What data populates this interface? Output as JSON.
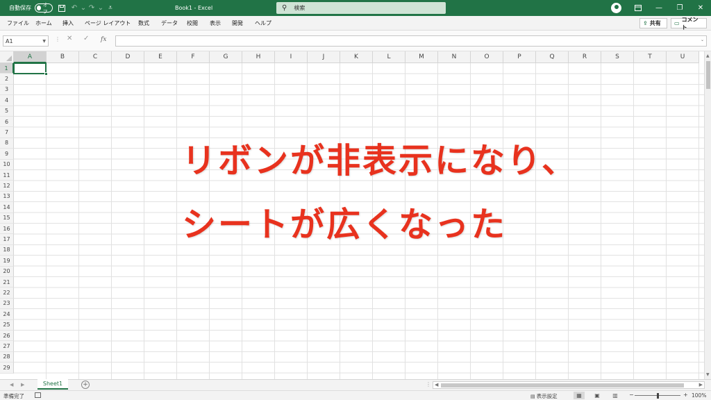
{
  "colors": {
    "excel_green": "#217346",
    "annotation_red": "#e8321e"
  },
  "titlebar": {
    "autosave_label": "自動保存",
    "autosave_state": "オフ",
    "title": "Book1 - Excel",
    "search_placeholder": "検索",
    "icons": [
      "save-icon",
      "undo-icon",
      "redo-icon",
      "customize-icon",
      "search-icon",
      "avatar-icon",
      "ribbon-display-icon",
      "minimize-icon",
      "restore-icon",
      "close-icon"
    ]
  },
  "menu": {
    "tabs": [
      "ファイル",
      "ホーム",
      "挿入",
      "ページ レイアウト",
      "数式",
      "データ",
      "校閲",
      "表示",
      "開発",
      "ヘルプ"
    ],
    "share": "共有",
    "comment": "コメント"
  },
  "formula_bar": {
    "name_box": "A1",
    "fx": "fx",
    "value": ""
  },
  "grid": {
    "columns": [
      "A",
      "B",
      "C",
      "D",
      "E",
      "F",
      "G",
      "H",
      "I",
      "J",
      "K",
      "L",
      "M",
      "N",
      "O",
      "P",
      "Q",
      "R",
      "S",
      "T",
      "U"
    ],
    "rows": [
      "1",
      "2",
      "3",
      "4",
      "5",
      "6",
      "7",
      "8",
      "9",
      "10",
      "11",
      "12",
      "13",
      "14",
      "15",
      "16",
      "17",
      "18",
      "19",
      "20",
      "21",
      "22",
      "23",
      "24",
      "25",
      "26",
      "27",
      "28",
      "29"
    ],
    "active_cell": "A1"
  },
  "annotation": {
    "line1": "リボンが非表示になり、",
    "line2": "シートが広くなった"
  },
  "sheets": {
    "tabs": [
      "Sheet1"
    ],
    "active": "Sheet1"
  },
  "status": {
    "ready": "準備完了",
    "display_settings": "表示設定",
    "zoom": "100%"
  }
}
